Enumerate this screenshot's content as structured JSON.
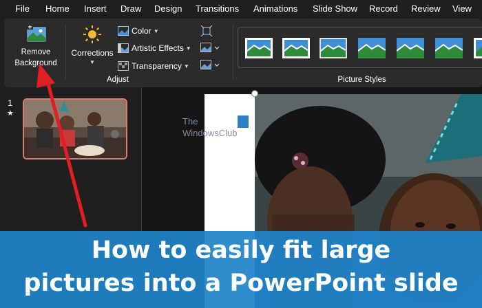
{
  "menu": [
    "File",
    "Home",
    "Insert",
    "Draw",
    "Design",
    "Transitions",
    "Animations",
    "Slide Show",
    "Record",
    "Review",
    "View"
  ],
  "ribbon": {
    "remove_bg": {
      "line1": "Remove",
      "line2": "Background",
      "icon": "remove-background-icon"
    },
    "corrections": {
      "label": "Corrections",
      "icon": "sun-icon"
    },
    "color_label": "Color",
    "artistic_label": "Artistic Effects",
    "transparency_label": "Transparency",
    "adjust_group": "Adjust",
    "styles_group": "Picture Styles"
  },
  "slides": {
    "current_number": "1",
    "star": "★"
  },
  "watermark": {
    "line1": "The",
    "line2": "WindowsClub"
  },
  "banner": {
    "line1": "How to easily fit large",
    "line2": "pictures into a PowerPoint slide"
  },
  "colors": {
    "banner": "#1e83c9",
    "thumb_border": "#e07a6c",
    "arrow": "#e01e24",
    "ribbon": "#2b2b2b"
  }
}
